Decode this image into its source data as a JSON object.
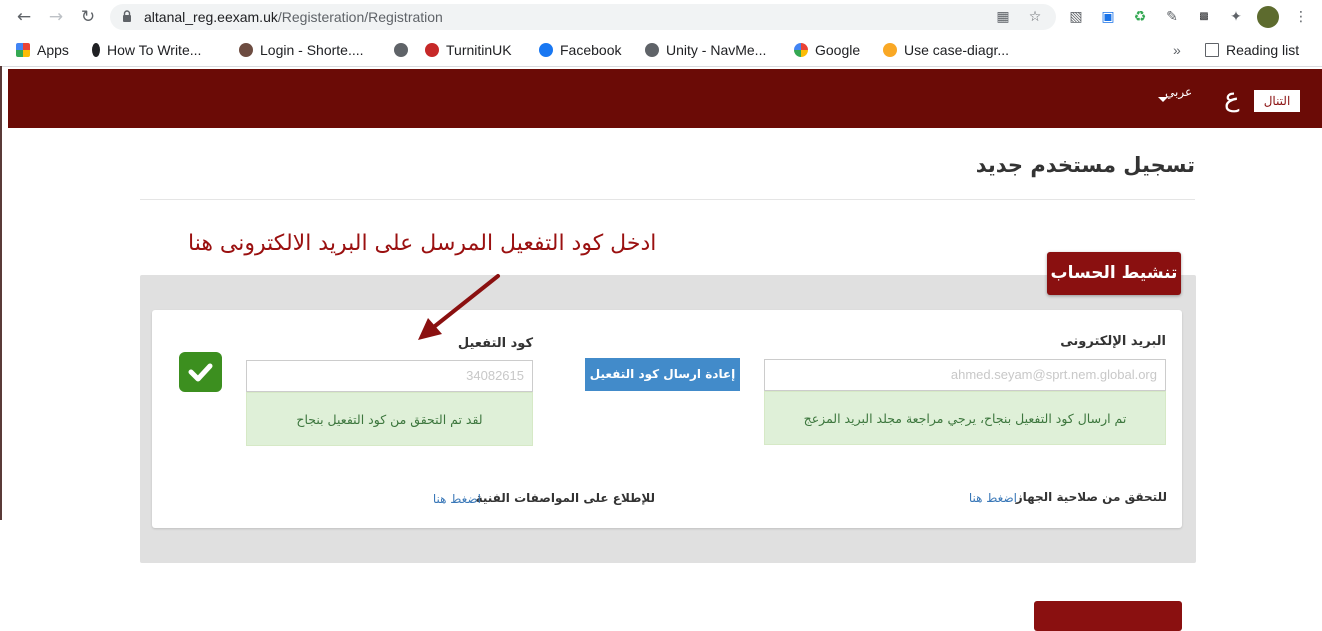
{
  "browser": {
    "url_host": "altanal_reg.eexam.uk",
    "url_path": "/Registeration/Registration",
    "bookmarks": [
      {
        "label": "Apps",
        "color": "#e94235"
      },
      {
        "label": "How To Write...",
        "color": "#202124"
      },
      {
        "label": "Login - Shorte....",
        "color": "#6d4c41"
      },
      {
        "label": "",
        "color": "#5f6368"
      },
      {
        "label": "TurnitinUK",
        "color": "#c62828"
      },
      {
        "label": "Facebook",
        "color": "#1877f2"
      },
      {
        "label": "Unity - NavMe...",
        "color": "#5f6368"
      },
      {
        "label": "Google",
        "color": "#4285f4"
      },
      {
        "label": "Use case-diagr...",
        "color": "#f9a825"
      }
    ],
    "more_bookmarks": "»",
    "reading_list": "Reading list"
  },
  "header": {
    "language": "عربي",
    "logo_text": "التنال",
    "logo_mark": "ع",
    "bg_color": "#6b0b06"
  },
  "page": {
    "title": "تسجيل مستخدم جديد",
    "annotation": "ادخل كود التفعيل المرسل على البريد الالكترونى هنا"
  },
  "activation": {
    "section_title": "تنشيط الحساب",
    "email_label": "البريد الإلكترونى",
    "email_value": "ahmed.seyam@sprt.nem.global.org",
    "email_success": "تم ارسال كود التفعيل بنجاح، يرجي مراجعة مجلد البريد المزعج",
    "resend_button": "إعادة ارسال كود التفعيل",
    "code_label": "كود التفعيل",
    "code_value": "34082615",
    "code_success": "لقد تم التحقق من كود التفعيل بنجاح",
    "device_check_label": "للتحقق من صلاحية الجهاز",
    "device_check_link": "اضغط هنا",
    "specs_label": "للإطلاع على المواصفات الفنية",
    "specs_link": "اضغط هنا",
    "accent_color": "#8a1010"
  }
}
